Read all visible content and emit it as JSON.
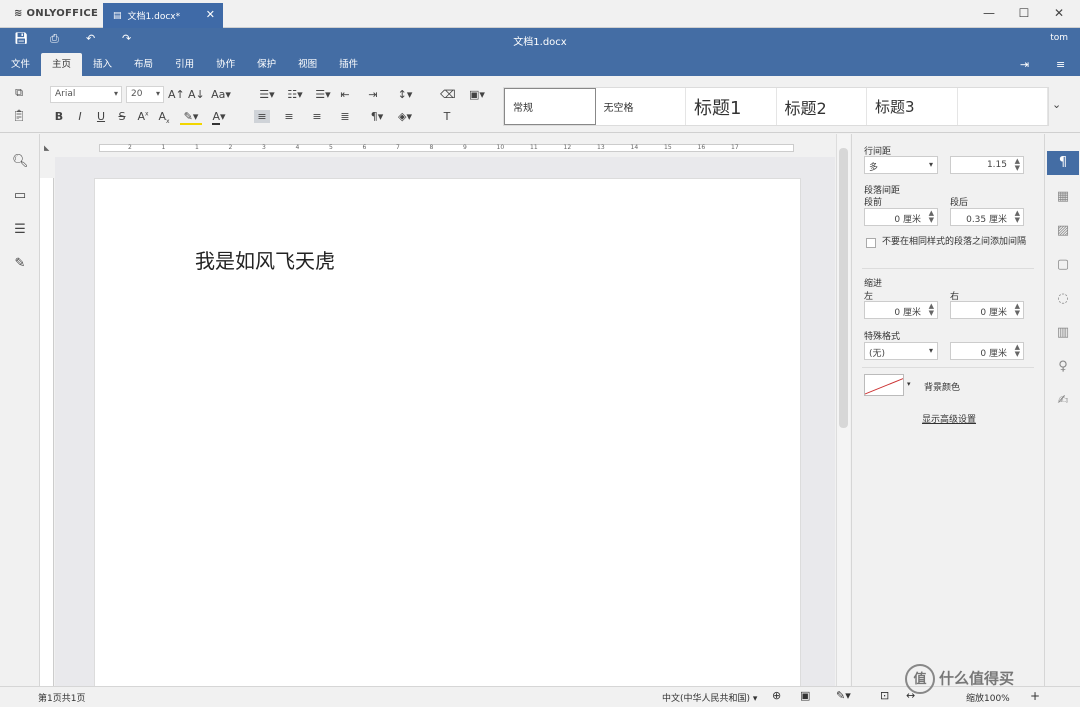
{
  "app": {
    "logo": "ONLYOFFICE"
  },
  "tab": {
    "title": "文档1.docx*"
  },
  "window": {
    "minimize": "—",
    "maximize": "☐",
    "close": "✕"
  },
  "header": {
    "title": "文档1.docx",
    "user": "tom",
    "tabs": [
      "文件",
      "主页",
      "插入",
      "布局",
      "引用",
      "协作",
      "保护",
      "视图",
      "插件"
    ],
    "active_tab": "主页"
  },
  "toolbar": {
    "font": "Arial",
    "size": "20",
    "bold": "B",
    "italic": "I",
    "underline": "U",
    "strike": "S",
    "superscript": "A",
    "subscript": "A",
    "font_color": "A",
    "paragraph_mark": "¶",
    "clear_style": "T"
  },
  "styles": [
    "常规",
    "无空格",
    "标题1",
    "标题2",
    "标题3",
    ""
  ],
  "document": {
    "text": "我是如风飞天虎"
  },
  "ruler": {
    "marks": [
      "2",
      "1",
      "1",
      "2",
      "3",
      "4",
      "5",
      "6",
      "7",
      "8",
      "9",
      "10",
      "11",
      "12",
      "13",
      "14",
      "15",
      "16",
      "17"
    ]
  },
  "right_panel": {
    "line_spacing_label": "行间距",
    "line_spacing_type": "多",
    "line_spacing_value": "1.15",
    "para_spacing_label": "段落间距",
    "before_label": "段前",
    "before_value": "0 厘米",
    "after_label": "段后",
    "after_value": "0.35 厘米",
    "dont_add_label": "不要在相同样式的段落之间添加间隔",
    "indent_label": "缩进",
    "left_label": "左",
    "left_value": "0 厘米",
    "right_label": "右",
    "right_value": "0 厘米",
    "special_label": "特殊格式",
    "special_type": "(无)",
    "special_value": "0 厘米",
    "bg_color_label": "背景颜色",
    "advanced": "显示高级设置"
  },
  "status": {
    "page": "第1页共1页",
    "language": "中文(中华人民共和国)",
    "zoom": "缩放100%"
  },
  "watermark": {
    "icon": "值",
    "text": "什么值得买"
  }
}
